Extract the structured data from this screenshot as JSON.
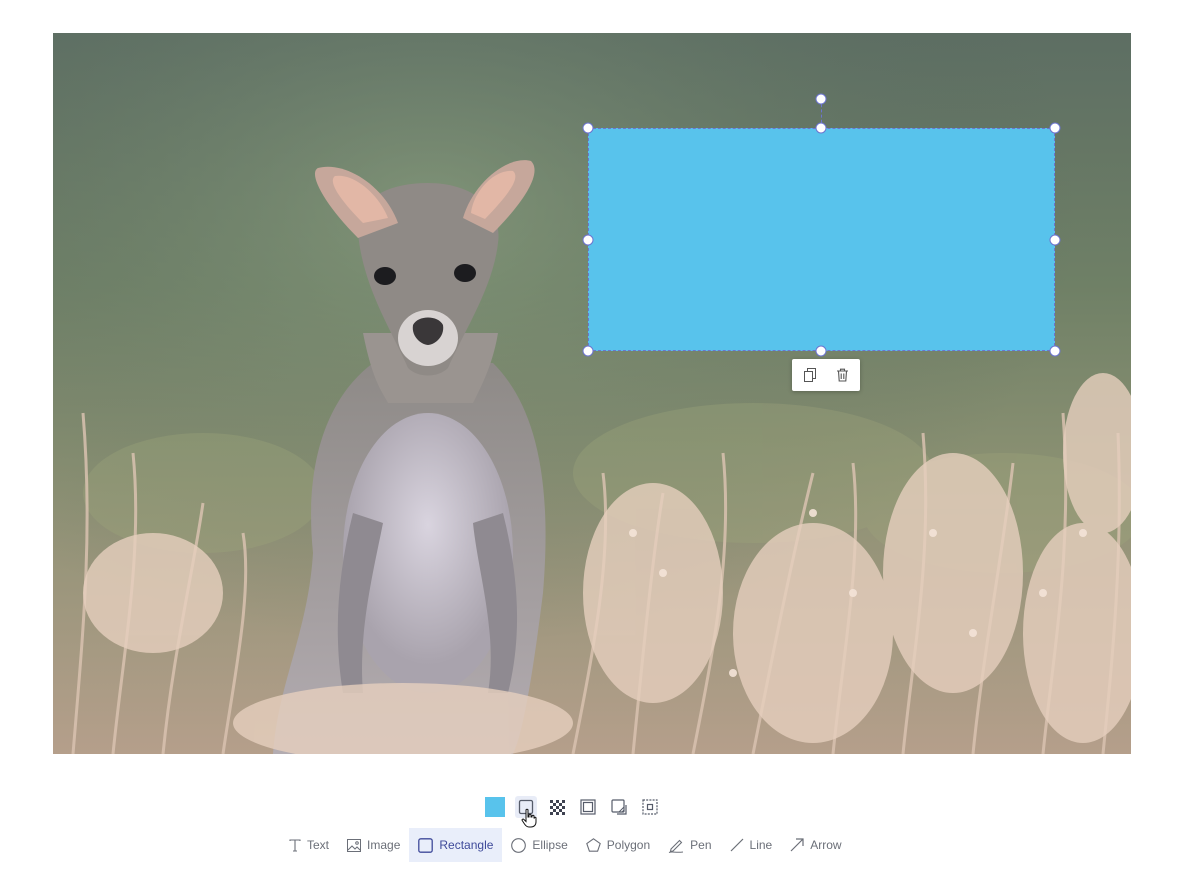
{
  "canvas": {
    "background": "photo of a young wallaby standing in tall grass",
    "annotation": {
      "type": "rectangle",
      "fill_color": "#58c3ec",
      "selection_color": "#6c74cf"
    }
  },
  "context_toolbar": {
    "duplicate_icon": "copy-icon",
    "delete_icon": "trash-icon"
  },
  "style_toolbar": {
    "items": [
      {
        "name": "fill-color",
        "color": "#58c3ec"
      },
      {
        "name": "stroke",
        "icon": "square-outline-icon"
      },
      {
        "name": "opacity",
        "icon": "checkerboard-icon"
      },
      {
        "name": "border-width",
        "icon": "double-square-icon"
      },
      {
        "name": "shadow",
        "icon": "shadow-square-icon"
      },
      {
        "name": "layer-order",
        "icon": "layer-square-icon"
      }
    ]
  },
  "tool_toolbar": {
    "active": "Rectangle",
    "tools": [
      {
        "label": "Text",
        "icon": "text-icon"
      },
      {
        "label": "Image",
        "icon": "image-icon"
      },
      {
        "label": "Rectangle",
        "icon": "rectangle-icon"
      },
      {
        "label": "Ellipse",
        "icon": "ellipse-icon"
      },
      {
        "label": "Polygon",
        "icon": "polygon-icon"
      },
      {
        "label": "Pen",
        "icon": "pen-icon"
      },
      {
        "label": "Line",
        "icon": "line-icon"
      },
      {
        "label": "Arrow",
        "icon": "arrow-icon"
      }
    ]
  }
}
